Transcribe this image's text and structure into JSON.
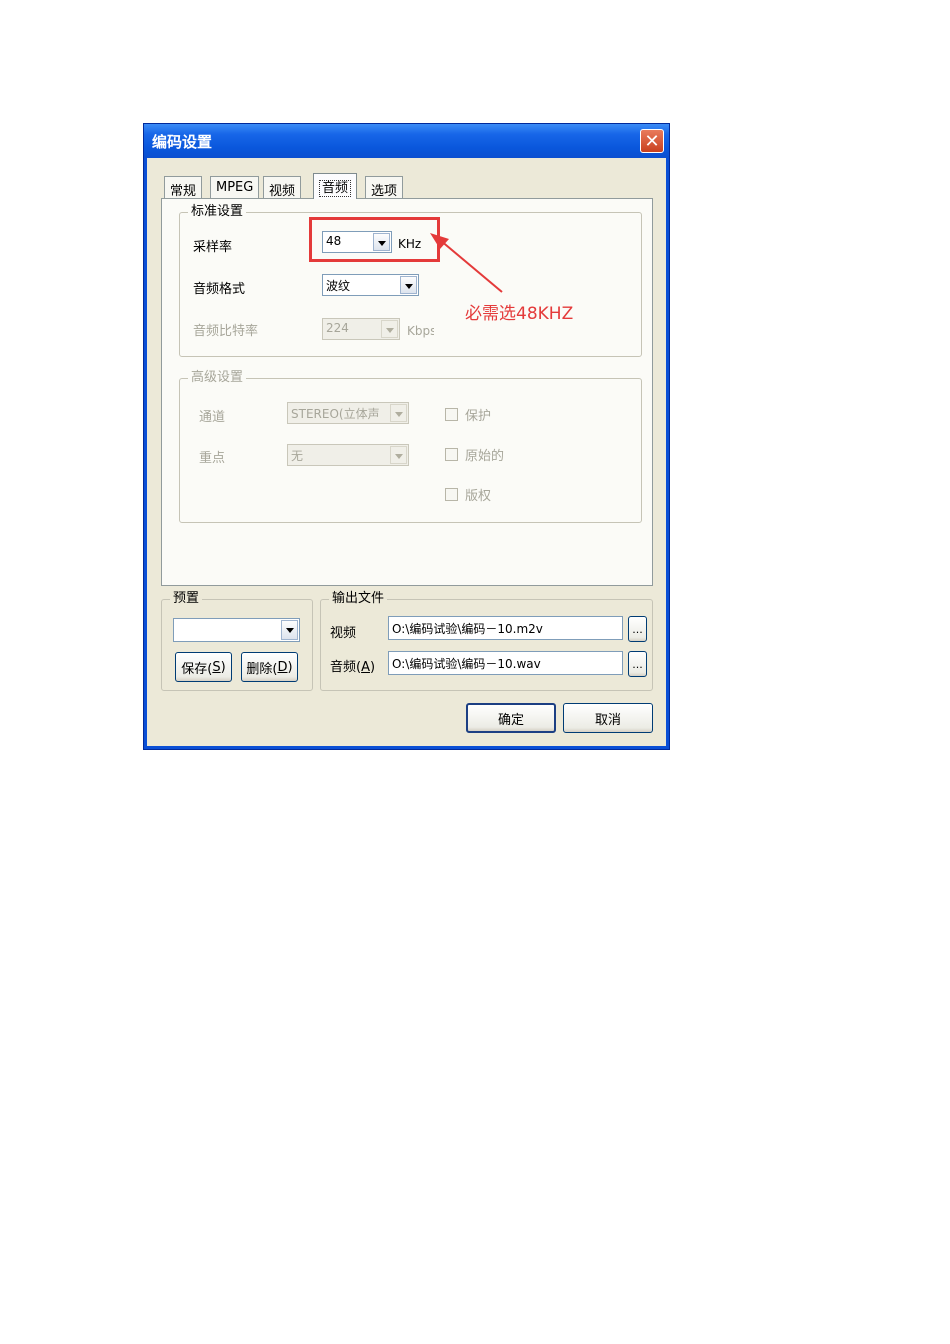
{
  "window": {
    "title": "编码设置"
  },
  "tabs": [
    {
      "label": "常规",
      "active": false
    },
    {
      "label": "MPEG",
      "active": false
    },
    {
      "label": "视频",
      "active": false
    },
    {
      "label": "音频",
      "active": true
    },
    {
      "label": "选项",
      "active": false
    }
  ],
  "standard": {
    "group_label": "标准设置",
    "sample_rate": {
      "label": "采样率",
      "value": "48",
      "unit": "KHz"
    },
    "audio_format": {
      "label": "音频格式",
      "value": "波纹"
    },
    "bitrate": {
      "label": "音频比特率",
      "value": "224",
      "unit": "Kbps",
      "disabled": true
    }
  },
  "advanced": {
    "group_label": "高级设置",
    "channel": {
      "label": "通道",
      "value": "STEREO(立体声"
    },
    "emphasis": {
      "label": "重点",
      "value": "无"
    },
    "checkboxes": [
      {
        "label": "保护",
        "checked": false
      },
      {
        "label": "原始的",
        "checked": false
      },
      {
        "label": "版权",
        "checked": false
      }
    ]
  },
  "annotation": {
    "text": "必需选48KHZ",
    "color": "#e43a3a"
  },
  "preset": {
    "group_label": "预置",
    "value": "",
    "save_label": "保存(",
    "save_key": "S",
    "save_tail": ")",
    "delete_label": "删除(",
    "delete_key": "D",
    "delete_tail": ")"
  },
  "output": {
    "group_label": "输出文件",
    "video": {
      "label": "视频",
      "path": "O:\\编码试验\\编码－10.m2v",
      "browse": "..."
    },
    "audio": {
      "label_main": "音频(",
      "label_key": "A",
      "label_tail": ")",
      "path": "O:\\编码试验\\编码－10.wav",
      "browse": "..."
    }
  },
  "buttons": {
    "ok": "确定",
    "cancel": "取消"
  },
  "colors": {
    "titlebar": "#0a57dc",
    "dialog_bg": "#ece9d8",
    "annotation": "#e43a3a"
  }
}
